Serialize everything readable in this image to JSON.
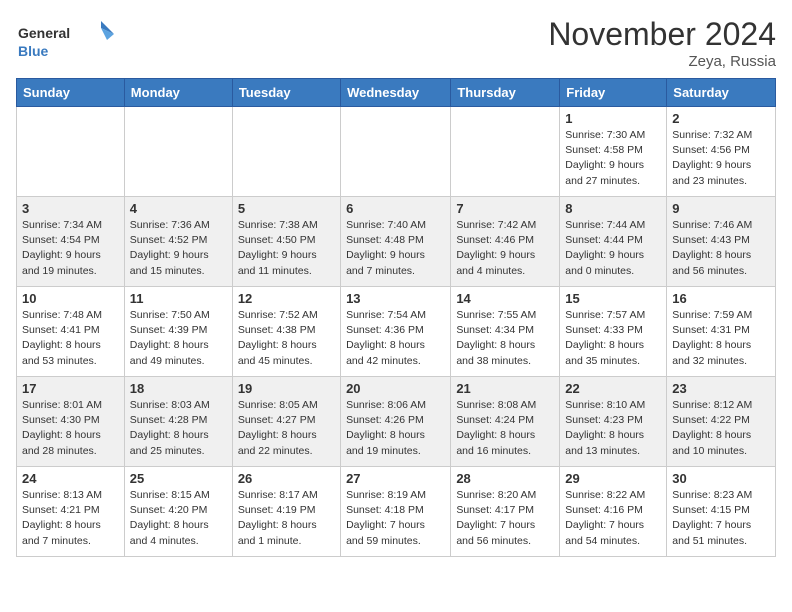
{
  "logo": {
    "general": "General",
    "blue": "Blue"
  },
  "title": "November 2024",
  "location": "Zeya, Russia",
  "weekdays": [
    "Sunday",
    "Monday",
    "Tuesday",
    "Wednesday",
    "Thursday",
    "Friday",
    "Saturday"
  ],
  "weeks": [
    {
      "days": [
        {
          "date": "",
          "info": ""
        },
        {
          "date": "",
          "info": ""
        },
        {
          "date": "",
          "info": ""
        },
        {
          "date": "",
          "info": ""
        },
        {
          "date": "",
          "info": ""
        },
        {
          "date": "1",
          "info": "Sunrise: 7:30 AM\nSunset: 4:58 PM\nDaylight: 9 hours\nand 27 minutes."
        },
        {
          "date": "2",
          "info": "Sunrise: 7:32 AM\nSunset: 4:56 PM\nDaylight: 9 hours\nand 23 minutes."
        }
      ]
    },
    {
      "days": [
        {
          "date": "3",
          "info": "Sunrise: 7:34 AM\nSunset: 4:54 PM\nDaylight: 9 hours\nand 19 minutes."
        },
        {
          "date": "4",
          "info": "Sunrise: 7:36 AM\nSunset: 4:52 PM\nDaylight: 9 hours\nand 15 minutes."
        },
        {
          "date": "5",
          "info": "Sunrise: 7:38 AM\nSunset: 4:50 PM\nDaylight: 9 hours\nand 11 minutes."
        },
        {
          "date": "6",
          "info": "Sunrise: 7:40 AM\nSunset: 4:48 PM\nDaylight: 9 hours\nand 7 minutes."
        },
        {
          "date": "7",
          "info": "Sunrise: 7:42 AM\nSunset: 4:46 PM\nDaylight: 9 hours\nand 4 minutes."
        },
        {
          "date": "8",
          "info": "Sunrise: 7:44 AM\nSunset: 4:44 PM\nDaylight: 9 hours\nand 0 minutes."
        },
        {
          "date": "9",
          "info": "Sunrise: 7:46 AM\nSunset: 4:43 PM\nDaylight: 8 hours\nand 56 minutes."
        }
      ]
    },
    {
      "days": [
        {
          "date": "10",
          "info": "Sunrise: 7:48 AM\nSunset: 4:41 PM\nDaylight: 8 hours\nand 53 minutes."
        },
        {
          "date": "11",
          "info": "Sunrise: 7:50 AM\nSunset: 4:39 PM\nDaylight: 8 hours\nand 49 minutes."
        },
        {
          "date": "12",
          "info": "Sunrise: 7:52 AM\nSunset: 4:38 PM\nDaylight: 8 hours\nand 45 minutes."
        },
        {
          "date": "13",
          "info": "Sunrise: 7:54 AM\nSunset: 4:36 PM\nDaylight: 8 hours\nand 42 minutes."
        },
        {
          "date": "14",
          "info": "Sunrise: 7:55 AM\nSunset: 4:34 PM\nDaylight: 8 hours\nand 38 minutes."
        },
        {
          "date": "15",
          "info": "Sunrise: 7:57 AM\nSunset: 4:33 PM\nDaylight: 8 hours\nand 35 minutes."
        },
        {
          "date": "16",
          "info": "Sunrise: 7:59 AM\nSunset: 4:31 PM\nDaylight: 8 hours\nand 32 minutes."
        }
      ]
    },
    {
      "days": [
        {
          "date": "17",
          "info": "Sunrise: 8:01 AM\nSunset: 4:30 PM\nDaylight: 8 hours\nand 28 minutes."
        },
        {
          "date": "18",
          "info": "Sunrise: 8:03 AM\nSunset: 4:28 PM\nDaylight: 8 hours\nand 25 minutes."
        },
        {
          "date": "19",
          "info": "Sunrise: 8:05 AM\nSunset: 4:27 PM\nDaylight: 8 hours\nand 22 minutes."
        },
        {
          "date": "20",
          "info": "Sunrise: 8:06 AM\nSunset: 4:26 PM\nDaylight: 8 hours\nand 19 minutes."
        },
        {
          "date": "21",
          "info": "Sunrise: 8:08 AM\nSunset: 4:24 PM\nDaylight: 8 hours\nand 16 minutes."
        },
        {
          "date": "22",
          "info": "Sunrise: 8:10 AM\nSunset: 4:23 PM\nDaylight: 8 hours\nand 13 minutes."
        },
        {
          "date": "23",
          "info": "Sunrise: 8:12 AM\nSunset: 4:22 PM\nDaylight: 8 hours\nand 10 minutes."
        }
      ]
    },
    {
      "days": [
        {
          "date": "24",
          "info": "Sunrise: 8:13 AM\nSunset: 4:21 PM\nDaylight: 8 hours\nand 7 minutes."
        },
        {
          "date": "25",
          "info": "Sunrise: 8:15 AM\nSunset: 4:20 PM\nDaylight: 8 hours\nand 4 minutes."
        },
        {
          "date": "26",
          "info": "Sunrise: 8:17 AM\nSunset: 4:19 PM\nDaylight: 8 hours\nand 1 minute."
        },
        {
          "date": "27",
          "info": "Sunrise: 8:19 AM\nSunset: 4:18 PM\nDaylight: 7 hours\nand 59 minutes."
        },
        {
          "date": "28",
          "info": "Sunrise: 8:20 AM\nSunset: 4:17 PM\nDaylight: 7 hours\nand 56 minutes."
        },
        {
          "date": "29",
          "info": "Sunrise: 8:22 AM\nSunset: 4:16 PM\nDaylight: 7 hours\nand 54 minutes."
        },
        {
          "date": "30",
          "info": "Sunrise: 8:23 AM\nSunset: 4:15 PM\nDaylight: 7 hours\nand 51 minutes."
        }
      ]
    }
  ]
}
